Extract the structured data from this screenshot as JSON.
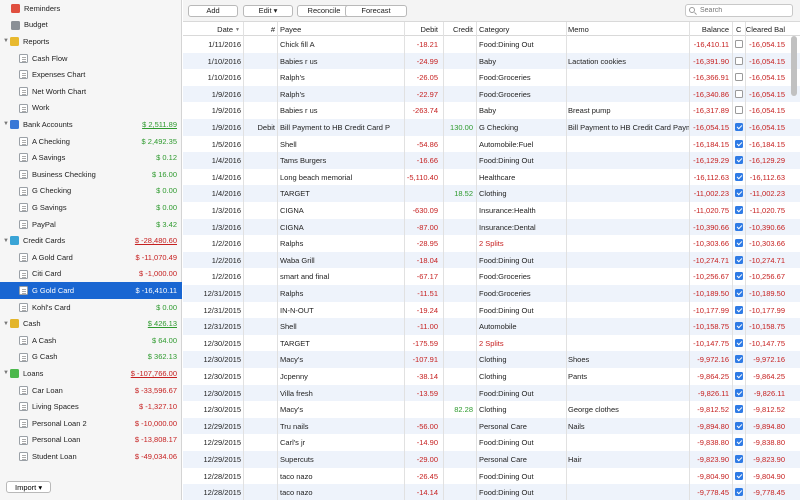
{
  "sidebar": {
    "items": [
      {
        "label": "Reminders",
        "value": "",
        "level": 1,
        "icon": "calendar-icon",
        "tri": false,
        "cls": ""
      },
      {
        "label": "Budget",
        "value": "",
        "level": 1,
        "icon": "budget-icon",
        "tri": false,
        "cls": ""
      },
      {
        "label": "Reports",
        "value": "",
        "level": 0,
        "icon": "reports-icon",
        "tri": true,
        "cls": ""
      },
      {
        "label": "Cash Flow",
        "value": "",
        "level": 2,
        "icon": "document-icon",
        "tri": false,
        "cls": ""
      },
      {
        "label": "Expenses Chart",
        "value": "",
        "level": 2,
        "icon": "document-icon",
        "tri": false,
        "cls": ""
      },
      {
        "label": "Net Worth Chart",
        "value": "",
        "level": 2,
        "icon": "document-icon",
        "tri": false,
        "cls": ""
      },
      {
        "label": "Work",
        "value": "",
        "level": 2,
        "icon": "document-icon",
        "tri": false,
        "cls": ""
      },
      {
        "label": "Bank Accounts",
        "value": "$ 2,511.89",
        "level": 0,
        "icon": "bank-icon",
        "tri": true,
        "cls": "pos ul"
      },
      {
        "label": "A Checking",
        "value": "$ 2,492.35",
        "level": 2,
        "icon": "document-icon",
        "tri": false,
        "cls": "pos"
      },
      {
        "label": "A Savings",
        "value": "$ 0.12",
        "level": 2,
        "icon": "document-icon",
        "tri": false,
        "cls": "pos"
      },
      {
        "label": "Business Checking",
        "value": "$ 16.00",
        "level": 2,
        "icon": "document-icon",
        "tri": false,
        "cls": "pos"
      },
      {
        "label": "G Checking",
        "value": "$ 0.00",
        "level": 2,
        "icon": "document-icon",
        "tri": false,
        "cls": "pos"
      },
      {
        "label": "G Savings",
        "value": "$ 0.00",
        "level": 2,
        "icon": "document-icon",
        "tri": false,
        "cls": "pos"
      },
      {
        "label": "PayPal",
        "value": "$ 3.42",
        "level": 2,
        "icon": "document-icon",
        "tri": false,
        "cls": "pos"
      },
      {
        "label": "Credit Cards",
        "value": "$ -28,480.60",
        "level": 0,
        "icon": "credit-card-icon",
        "tri": true,
        "cls": "neg ul"
      },
      {
        "label": "A Gold Card",
        "value": "$ -11,070.49",
        "level": 2,
        "icon": "document-icon",
        "tri": false,
        "cls": "neg"
      },
      {
        "label": "Citi Card",
        "value": "$ -1,000.00",
        "level": 2,
        "icon": "document-icon",
        "tri": false,
        "cls": "neg"
      },
      {
        "label": "G Gold Card",
        "value": "$ -16,410.11",
        "level": 2,
        "icon": "document-icon",
        "tri": false,
        "cls": "neg",
        "selected": true
      },
      {
        "label": "Kohl's Card",
        "value": "$ 0.00",
        "level": 2,
        "icon": "document-icon",
        "tri": false,
        "cls": "pos"
      },
      {
        "label": "Cash",
        "value": "$ 426.13",
        "level": 0,
        "icon": "cash-icon",
        "tri": true,
        "cls": "pos ul"
      },
      {
        "label": "A Cash",
        "value": "$ 64.00",
        "level": 2,
        "icon": "document-icon",
        "tri": false,
        "cls": "pos"
      },
      {
        "label": "G Cash",
        "value": "$ 362.13",
        "level": 2,
        "icon": "document-icon",
        "tri": false,
        "cls": "pos"
      },
      {
        "label": "Loans",
        "value": "$ -107,766.00",
        "level": 0,
        "icon": "loans-icon",
        "tri": true,
        "cls": "neg ul"
      },
      {
        "label": "Car Loan",
        "value": "$ -33,596.67",
        "level": 2,
        "icon": "document-icon",
        "tri": false,
        "cls": "neg"
      },
      {
        "label": "Living Spaces",
        "value": "$ -1,327.10",
        "level": 2,
        "icon": "document-icon",
        "tri": false,
        "cls": "neg"
      },
      {
        "label": "Personal Loan 2",
        "value": "$ -10,000.00",
        "level": 2,
        "icon": "document-icon",
        "tri": false,
        "cls": "neg"
      },
      {
        "label": "Personal Loan",
        "value": "$ -13,808.17",
        "level": 2,
        "icon": "document-icon",
        "tri": false,
        "cls": "neg"
      },
      {
        "label": "Student Loan",
        "value": "$ -49,034.06",
        "level": 2,
        "icon": "document-icon",
        "tri": false,
        "cls": "neg"
      }
    ],
    "import_label": "Import ▾"
  },
  "toolbar": {
    "add_label": "Add",
    "edit_label": "Edit ▾",
    "reconcile_label": "Reconcile",
    "forecast_label": "Forecast",
    "search_placeholder": "Search"
  },
  "table": {
    "headers": {
      "date": "Date",
      "num": "#",
      "payee": "Payee",
      "debit": "Debit",
      "credit": "Credit",
      "category": "Category",
      "memo": "Memo",
      "balance": "Balance",
      "cleared_flag": "C",
      "cleared_bal": "Cleared Bal"
    },
    "rows": [
      {
        "date": "1/11/2016",
        "num": "",
        "payee": "Chick fill A",
        "debit": "-18.21",
        "credit": "",
        "category": "Food:Dining Out",
        "memo": "",
        "balance": "-16,410.11",
        "cleared": false,
        "cleared_bal": "-16,054.15"
      },
      {
        "date": "1/10/2016",
        "num": "",
        "payee": "Babies r us",
        "debit": "-24.99",
        "credit": "",
        "category": "Baby",
        "memo": "Lactation cookies",
        "balance": "-16,391.90",
        "cleared": false,
        "cleared_bal": "-16,054.15"
      },
      {
        "date": "1/10/2016",
        "num": "",
        "payee": "Ralph's",
        "debit": "-26.05",
        "credit": "",
        "category": "Food:Groceries",
        "memo": "",
        "balance": "-16,366.91",
        "cleared": false,
        "cleared_bal": "-16,054.15"
      },
      {
        "date": "1/9/2016",
        "num": "",
        "payee": "Ralph's",
        "debit": "-22.97",
        "credit": "",
        "category": "Food:Groceries",
        "memo": "",
        "balance": "-16,340.86",
        "cleared": false,
        "cleared_bal": "-16,054.15"
      },
      {
        "date": "1/9/2016",
        "num": "",
        "payee": "Babies r us",
        "debit": "-263.74",
        "credit": "",
        "category": "Baby",
        "memo": "Breast pump",
        "balance": "-16,317.89",
        "cleared": false,
        "cleared_bal": "-16,054.15"
      },
      {
        "date": "1/9/2016",
        "num": "Debit",
        "payee": "Bill Payment to HB Credit Card P",
        "debit": "",
        "credit": "130.00",
        "category": "G Checking",
        "memo": "Bill Payment to HB Credit Card Payme...",
        "balance": "-16,054.15",
        "cleared": true,
        "cleared_bal": "-16,054.15"
      },
      {
        "date": "1/5/2016",
        "num": "",
        "payee": "Shell",
        "debit": "-54.86",
        "credit": "",
        "category": "Automobile:Fuel",
        "memo": "",
        "balance": "-16,184.15",
        "cleared": true,
        "cleared_bal": "-16,184.15"
      },
      {
        "date": "1/4/2016",
        "num": "",
        "payee": "Tams Burgers",
        "debit": "-16.66",
        "credit": "",
        "category": "Food:Dining Out",
        "memo": "",
        "balance": "-16,129.29",
        "cleared": true,
        "cleared_bal": "-16,129.29"
      },
      {
        "date": "1/4/2016",
        "num": "",
        "payee": "Long beach memorial",
        "debit": "-5,110.40",
        "credit": "",
        "category": "Healthcare",
        "memo": "",
        "balance": "-16,112.63",
        "cleared": true,
        "cleared_bal": "-16,112.63"
      },
      {
        "date": "1/4/2016",
        "num": "",
        "payee": "TARGET",
        "debit": "",
        "credit": "18.52",
        "category": "Clothing",
        "memo": "",
        "balance": "-11,002.23",
        "cleared": true,
        "cleared_bal": "-11,002.23"
      },
      {
        "date": "1/3/2016",
        "num": "",
        "payee": "CIGNA",
        "debit": "-630.09",
        "credit": "",
        "category": "Insurance:Health",
        "memo": "",
        "balance": "-11,020.75",
        "cleared": true,
        "cleared_bal": "-11,020.75"
      },
      {
        "date": "1/3/2016",
        "num": "",
        "payee": "CIGNA",
        "debit": "-87.00",
        "credit": "",
        "category": "Insurance:Dental",
        "memo": "",
        "balance": "-10,390.66",
        "cleared": true,
        "cleared_bal": "-10,390.66"
      },
      {
        "date": "1/2/2016",
        "num": "",
        "payee": "Ralphs",
        "debit": "-28.95",
        "credit": "",
        "category": "2 Splits",
        "memo": "",
        "balance": "-10,303.66",
        "cleared": true,
        "cleared_bal": "-10,303.66",
        "split": true
      },
      {
        "date": "1/2/2016",
        "num": "",
        "payee": "Waba Grill",
        "debit": "-18.04",
        "credit": "",
        "category": "Food:Dining Out",
        "memo": "",
        "balance": "-10,274.71",
        "cleared": true,
        "cleared_bal": "-10,274.71"
      },
      {
        "date": "1/2/2016",
        "num": "",
        "payee": "smart and final",
        "debit": "-67.17",
        "credit": "",
        "category": "Food:Groceries",
        "memo": "",
        "balance": "-10,256.67",
        "cleared": true,
        "cleared_bal": "-10,256.67"
      },
      {
        "date": "12/31/2015",
        "num": "",
        "payee": "Ralphs",
        "debit": "-11.51",
        "credit": "",
        "category": "Food:Groceries",
        "memo": "",
        "balance": "-10,189.50",
        "cleared": true,
        "cleared_bal": "-10,189.50"
      },
      {
        "date": "12/31/2015",
        "num": "",
        "payee": "IN-N-OUT",
        "debit": "-19.24",
        "credit": "",
        "category": "Food:Dining Out",
        "memo": "",
        "balance": "-10,177.99",
        "cleared": true,
        "cleared_bal": "-10,177.99"
      },
      {
        "date": "12/31/2015",
        "num": "",
        "payee": "Shell",
        "debit": "-11.00",
        "credit": "",
        "category": "Automobile",
        "memo": "",
        "balance": "-10,158.75",
        "cleared": true,
        "cleared_bal": "-10,158.75"
      },
      {
        "date": "12/30/2015",
        "num": "",
        "payee": "TARGET",
        "debit": "-175.59",
        "credit": "",
        "category": "2 Splits",
        "memo": "",
        "balance": "-10,147.75",
        "cleared": true,
        "cleared_bal": "-10,147.75",
        "split": true
      },
      {
        "date": "12/30/2015",
        "num": "",
        "payee": "Macy's",
        "debit": "-107.91",
        "credit": "",
        "category": "Clothing",
        "memo": "Shoes",
        "balance": "-9,972.16",
        "cleared": true,
        "cleared_bal": "-9,972.16"
      },
      {
        "date": "12/30/2015",
        "num": "",
        "payee": "Jcpenny",
        "debit": "-38.14",
        "credit": "",
        "category": "Clothing",
        "memo": "Pants",
        "balance": "-9,864.25",
        "cleared": true,
        "cleared_bal": "-9,864.25"
      },
      {
        "date": "12/30/2015",
        "num": "",
        "payee": "Villa fresh",
        "debit": "-13.59",
        "credit": "",
        "category": "Food:Dining Out",
        "memo": "",
        "balance": "-9,826.11",
        "cleared": true,
        "cleared_bal": "-9,826.11"
      },
      {
        "date": "12/30/2015",
        "num": "",
        "payee": "Macy's",
        "debit": "",
        "credit": "82.28",
        "category": "Clothing",
        "memo": "George clothes",
        "balance": "-9,812.52",
        "cleared": true,
        "cleared_bal": "-9,812.52"
      },
      {
        "date": "12/29/2015",
        "num": "",
        "payee": "Tru nails",
        "debit": "-56.00",
        "credit": "",
        "category": "Personal Care",
        "memo": "Nails",
        "balance": "-9,894.80",
        "cleared": true,
        "cleared_bal": "-9,894.80"
      },
      {
        "date": "12/29/2015",
        "num": "",
        "payee": "Carl's jr",
        "debit": "-14.90",
        "credit": "",
        "category": "Food:Dining Out",
        "memo": "",
        "balance": "-9,838.80",
        "cleared": true,
        "cleared_bal": "-9,838.80"
      },
      {
        "date": "12/29/2015",
        "num": "",
        "payee": "Supercuts",
        "debit": "-29.00",
        "credit": "",
        "category": "Personal Care",
        "memo": "Hair",
        "balance": "-9,823.90",
        "cleared": true,
        "cleared_bal": "-9,823.90"
      },
      {
        "date": "12/28/2015",
        "num": "",
        "payee": "taco nazo",
        "debit": "-26.45",
        "credit": "",
        "category": "Food:Dining Out",
        "memo": "",
        "balance": "-9,804.90",
        "cleared": true,
        "cleared_bal": "-9,804.90"
      },
      {
        "date": "12/28/2015",
        "num": "",
        "payee": "taco nazo",
        "debit": "-14.14",
        "credit": "",
        "category": "Food:Dining Out",
        "memo": "",
        "balance": "-9,778.45",
        "cleared": true,
        "cleared_bal": "-9,778.45"
      }
    ]
  },
  "colors": {
    "positive": "#2e9a2e",
    "negative": "#c62020",
    "selection": "#1966d2",
    "row_alt": "#eef3fb"
  }
}
